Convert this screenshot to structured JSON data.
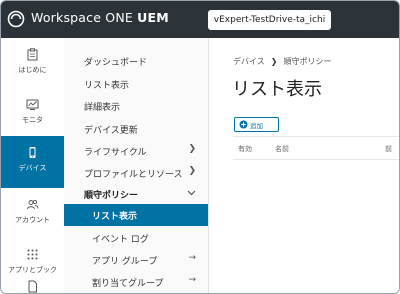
{
  "header": {
    "brand_name": "Workspace ONE",
    "brand_suffix": "UEM",
    "org_group": "vExpert-TestDrive-ta_ichi"
  },
  "nav": {
    "items": [
      {
        "label": "はじめに",
        "icon": "clipboard-icon"
      },
      {
        "label": "モニタ",
        "icon": "monitor-icon"
      },
      {
        "label": "デバイス",
        "icon": "device-icon",
        "active": true
      },
      {
        "label": "アカウント",
        "icon": "users-icon"
      },
      {
        "label": "アプリとブック",
        "icon": "apps-grid-icon"
      }
    ]
  },
  "submenu": {
    "items": [
      {
        "label": "ダッシュボード"
      },
      {
        "label": "リスト表示"
      },
      {
        "label": "詳細表示"
      },
      {
        "label": "デバイス更新"
      },
      {
        "label": "ライフサイクル"
      },
      {
        "label": "プロファイルとリソース"
      },
      {
        "label": "順守ポリシー"
      },
      {
        "label": "リスト表示"
      },
      {
        "label": "イベント ログ"
      },
      {
        "label": "アプリ グループ"
      },
      {
        "label": "割り当てグループ"
      }
    ]
  },
  "main": {
    "breadcrumb": [
      "デバイス",
      "順守ポリシー"
    ],
    "title": "リスト表示",
    "add_label": "追加",
    "columns": [
      "有効",
      "名前",
      "前"
    ]
  },
  "colors": {
    "header_bg": "#2c3338",
    "accent": "#0072a3"
  }
}
